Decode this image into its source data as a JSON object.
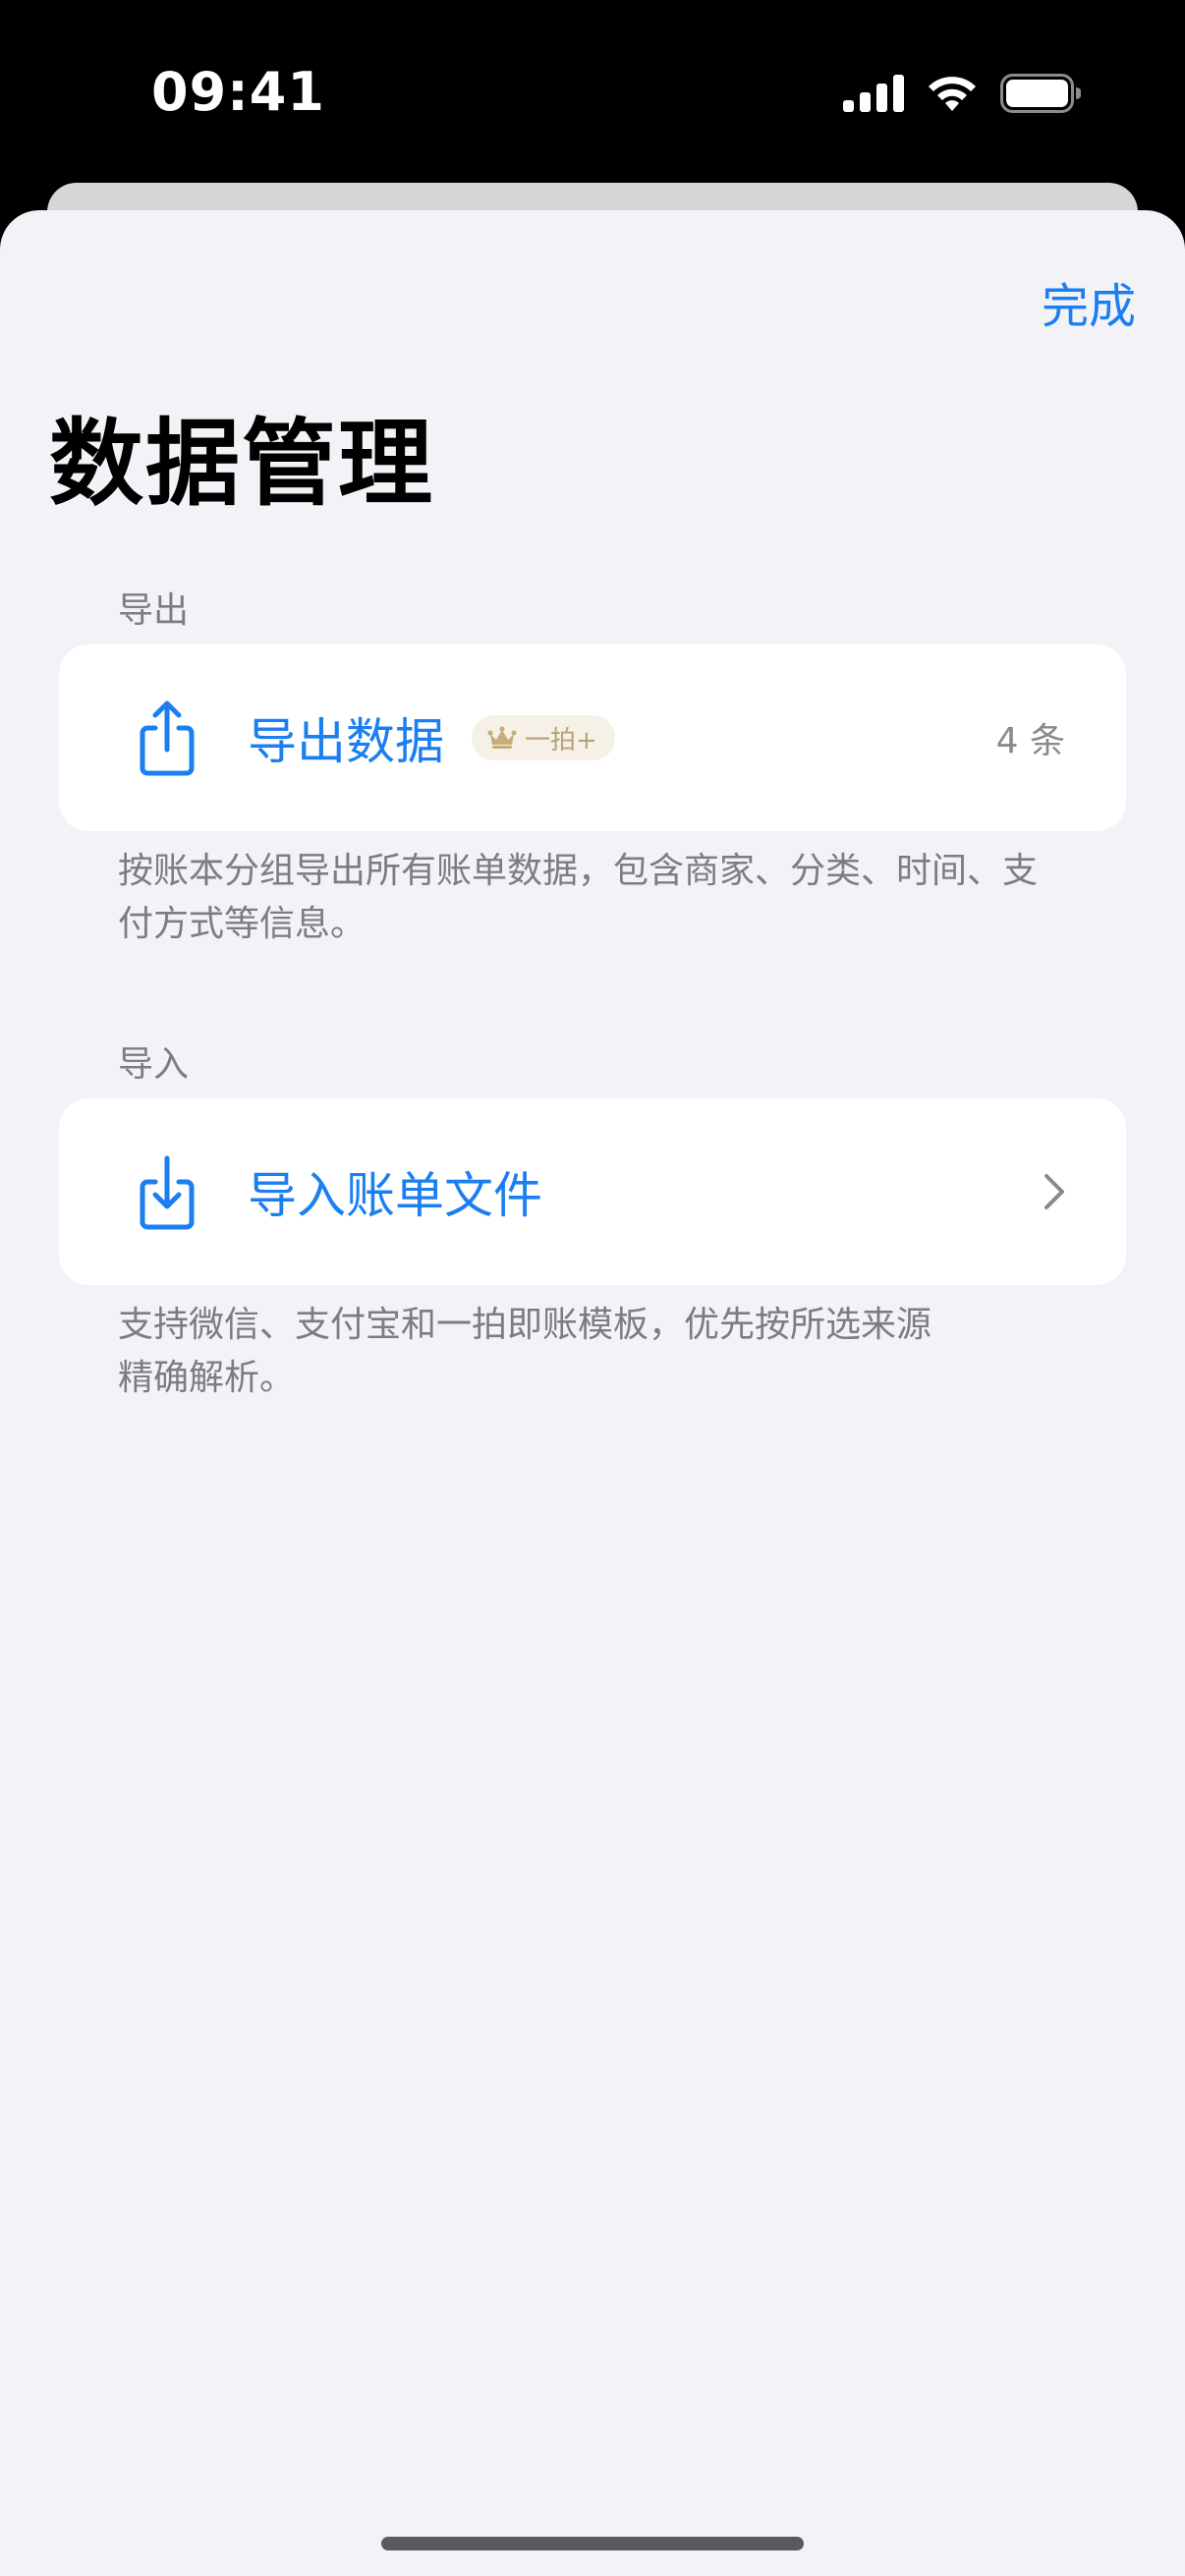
{
  "status_bar": {
    "time": "09:41"
  },
  "nav": {
    "done_label": "完成"
  },
  "page": {
    "title": "数据管理"
  },
  "export_section": {
    "header": "导出",
    "row_label": "导出数据",
    "badge_label": "一拍+",
    "badge_icon": "crown-icon",
    "count": "4 条",
    "row_icon": "share-export-icon",
    "footer": "按账本分组导出所有账单数据，包含商家、分类、时间、支付方式等信息。"
  },
  "import_section": {
    "header": "导入",
    "row_label": "导入账单文件",
    "row_icon": "download-import-icon",
    "footer_line1": "支持微信、支付宝和一拍即账模板，优先按所选来源",
    "footer_line2": "精确解析。"
  },
  "colors": {
    "accent": "#1a7ff0",
    "background": "#f2f2f7",
    "badge_bg": "#f5f1e6",
    "badge_text": "#b5a27a"
  }
}
